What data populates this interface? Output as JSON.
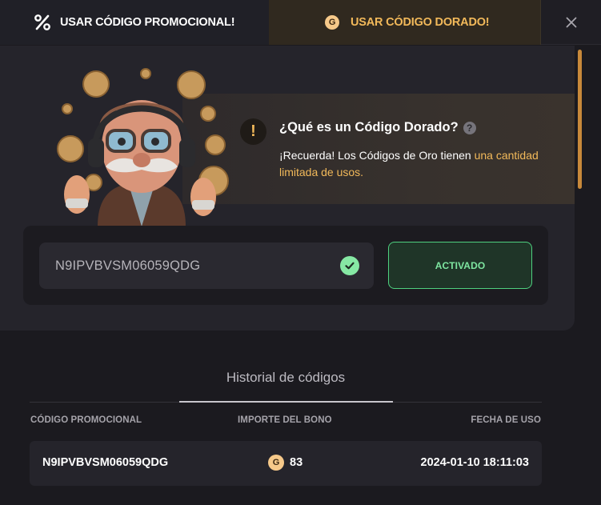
{
  "tabs": {
    "promo_label": "USAR CÓDIGO PROMOCIONAL!",
    "gold_label": "USAR CÓDIGO DORADO!",
    "gold_coin_letter": "G",
    "promo_icon": "percent-icon",
    "close_icon": "close-icon"
  },
  "info": {
    "title": "¿Qué es un Código Dorado?",
    "help_glyph": "?",
    "text_prefix": "¡Recuerda! Los Códigos de Oro tienen ",
    "text_highlight": "una cantidad limitada de usos",
    "text_suffix": ".",
    "warning_glyph": "!"
  },
  "code_entry": {
    "value": "N9IPVBVSM06059QDG",
    "status_button": "ACTIVADO"
  },
  "history": {
    "title": "Historial de códigos",
    "columns": [
      "CÓDIGO PROMOCIONAL",
      "IMPORTE DEL BONO",
      "FECHA DE USO"
    ],
    "rows": [
      {
        "code": "N9IPVBVSM06059QDG",
        "coin": "G",
        "amount": "83",
        "date": "2024-01-10 18:11:03"
      }
    ]
  },
  "colors": {
    "gold": "#f2b95a",
    "green": "#4ed07f",
    "background": "#1b1a1f"
  }
}
